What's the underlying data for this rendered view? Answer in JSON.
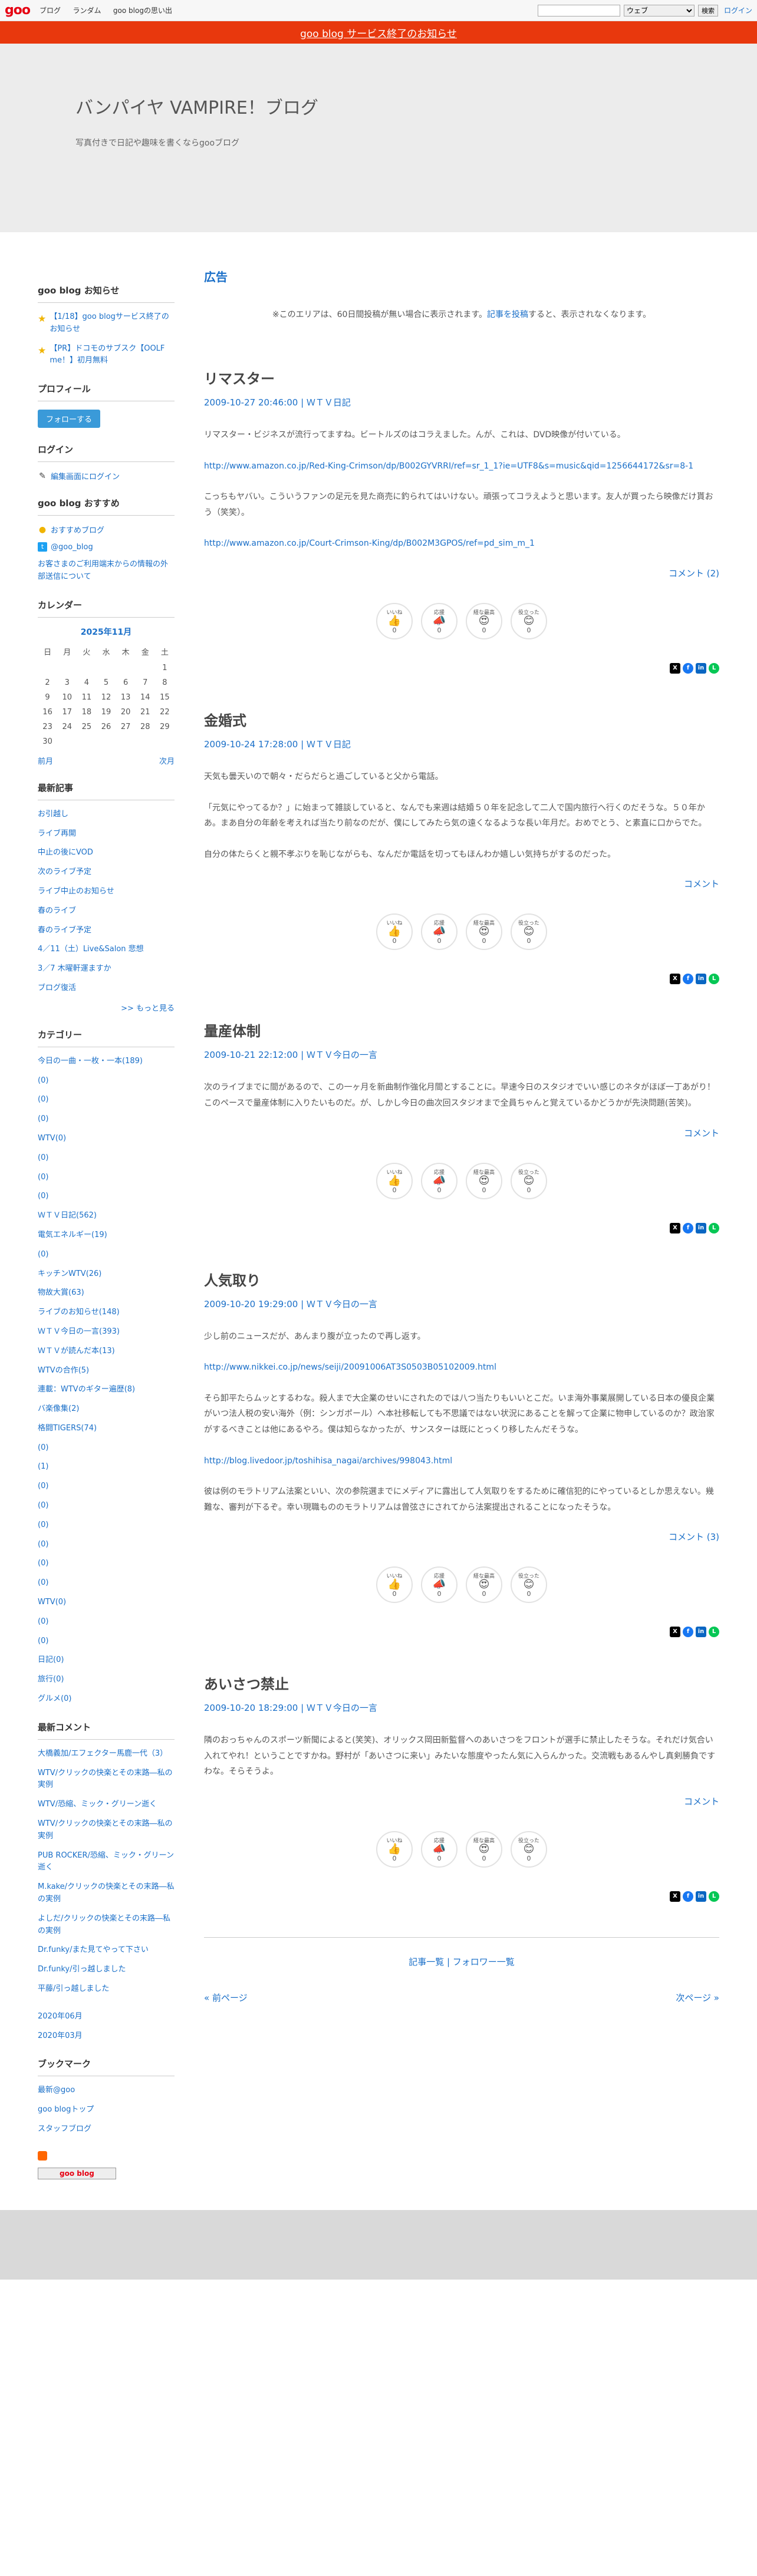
{
  "topbar": {
    "logo": "goo",
    "nav": [
      "ブログ",
      "ランダム",
      "goo blogの思い出"
    ],
    "search_scope": "ウェブ",
    "search_button": "検索",
    "login": "ログイン"
  },
  "notice_bar": "goo blog サービス終了のお知らせ",
  "header": {
    "title": "バンパイヤ VAMPIRE！ブログ",
    "description": "写真付きで日記や趣味を書くならgooブログ"
  },
  "sidebar": {
    "notice": {
      "title": "goo blog お知らせ",
      "items": [
        "【1/18】goo blogサービス終了のお知らせ",
        "【PR】ドコモのサブスク【OOLF me！】初月無料"
      ]
    },
    "profile": {
      "title": "プロフィール",
      "follow": "フォローする"
    },
    "login": {
      "title": "ログイン",
      "link": "編集画面にログイン"
    },
    "recommend": {
      "title": "goo blog おすすめ",
      "items": [
        "おすすめブログ",
        "@goo_blog",
        "お客さまのご利用端末からの情報の外部送信について"
      ]
    },
    "calendar": {
      "title": "カレンダー",
      "month": "2025年11月",
      "weekdays": [
        "日",
        "月",
        "火",
        "水",
        "木",
        "金",
        "土"
      ],
      "weeks": [
        [
          "",
          "",
          "",
          "",
          "",
          "",
          "1"
        ],
        [
          "2",
          "3",
          "4",
          "5",
          "6",
          "7",
          "8"
        ],
        [
          "9",
          "10",
          "11",
          "12",
          "13",
          "14",
          "15"
        ],
        [
          "16",
          "17",
          "18",
          "19",
          "20",
          "21",
          "22"
        ],
        [
          "23",
          "24",
          "25",
          "26",
          "27",
          "28",
          "29"
        ],
        [
          "30",
          "",
          "",
          "",
          "",
          "",
          ""
        ]
      ],
      "prev": "前月",
      "next": "次月"
    },
    "recent": {
      "title": "最新記事",
      "items": [
        "お引越し",
        "ライブ再開",
        "中止の後にVOD",
        "次のライブ予定",
        "ライブ中止のお知らせ",
        "春のライブ",
        "春のライブ予定",
        "4／11（土）Live&Salon 悲想",
        "3／7 木曜軒運ますか",
        "ブログ復活"
      ],
      "more": ">> もっと見る"
    },
    "categories": {
      "title": "カテゴリー",
      "items": [
        "今日の一曲・一枚・一本(189)",
        "(0)",
        "(0)",
        "(0)",
        "WTV(0)",
        "(0)",
        "(0)",
        "(0)",
        "ＷＴＶ日記(562)",
        "電気エネルギー(19)",
        "(0)",
        "キッチンWTV(26)",
        "物故大賞(63)",
        "ライブのお知らせ(148)",
        "ＷＴＶ今日の一言(393)",
        "ＷＴＶが読んだ本(13)",
        "WTVの合作(5)",
        "連載：WTVのギター遍歴(8)",
        "バ楽像集(2)",
        "格闘TIGERS(74)",
        "(0)",
        "(1)",
        "(0)",
        "(0)",
        "(0)",
        "(0)",
        "(0)",
        "(0)",
        "WTV(0)",
        "(0)",
        "(0)",
        "日記(0)",
        "旅行(0)",
        "グルメ(0)"
      ]
    },
    "comments": {
      "title": "最新コメント",
      "items": [
        "大橋義加/エフェクター馬鹿一代（3）",
        "WTV/クリックの快楽とその末路―私の実例",
        "WTV/恐縮、ミック・グリーン逝く",
        "WTV/クリックの快楽とその末路―私の実例",
        "PUB ROCKER/恐縮、ミック・グリーン逝く",
        "M.kake/クリックの快楽とその末路―私の実例",
        "よしだ/クリックの快楽とその末路―私の実例",
        "Dr.funky/また見てやって下さい",
        "Dr.funky/引っ越しました",
        "平藤/引っ越しました"
      ]
    },
    "archive": {
      "items": [
        "2020年06月",
        "2020年03月"
      ]
    },
    "bookmark": {
      "title": "ブックマーク",
      "items": [
        "最新@goo",
        "goo blogトップ",
        "スタッフブログ"
      ]
    },
    "footer_badge": "goo blog"
  },
  "main": {
    "ad_title": "広告",
    "ad_note_pre": "※このエリアは、60日間投稿が無い場合に表示されます。",
    "ad_note_link": "記事を投稿",
    "ad_note_post": "すると、表示されなくなります。",
    "reaction_labels": [
      "いいね",
      "応援",
      "経な最高",
      "役立った"
    ],
    "reaction_counts": [
      "0",
      "0",
      "0",
      "0"
    ],
    "entries": [
      {
        "title": "リマスター",
        "date": "2009-10-27 20:46:00",
        "category": "ＷＴＶ日記",
        "p1": "リマスター・ビジネスが流行ってますね。ビートルズのはコラえました。んが、これは、DVD映像が付いている。",
        "link1": "http://www.amazon.co.jp/Red-King-Crimson/dp/B002GYVRRI/ref=sr_1_1?ie=UTF8&s=music&qid=1256644172&sr=8-1",
        "p2": "こっちもヤバい。こういうファンの足元を見た商売に釣られてはいけない。頑張ってコラえようと思います。友人が買ったら映像だけ貰おう（笑笑）。",
        "link2": "http://www.amazon.co.jp/Court-Crimson-King/dp/B002M3GPOS/ref=pd_sim_m_1",
        "comment": "コメント (2)"
      },
      {
        "title": "金婚式",
        "date": "2009-10-24 17:28:00",
        "category": "ＷＴＶ日記",
        "p1": "天気も曇天いので朝々・だらだらと過ごしていると父から電話。",
        "p2": "「元気にやってるか？」に始まって雑談していると、なんでも来週は結婚５０年を記念して二人で国内旅行へ行くのだそうな。５０年かあ。まあ自分の年齢を考えれば当たり前なのだが、僕にしてみたら気の遠くなるような長い年月だ。おめでとう、と素直に口からでた。",
        "p3": "自分の体たらくと親不孝ぶりを恥じながらも、なんだか電話を切ってもほんわか嬉しい気持ちがするのだった。",
        "comment": "コメント"
      },
      {
        "title": "量産体制",
        "date": "2009-10-21 22:12:00",
        "category": "ＷＴＶ今日の一言",
        "p1": "次のライブまでに間があるので、この一ヶ月を新曲制作強化月間とすることに。早速今日のスタジオでいい感じのネタがほぼ一丁あがり！このペースで量産体制に入りたいものだ。が、しかし今日の曲次回スタジオまで全員ちゃんと覚えているかどうかが先決問題(苦笑)。",
        "comment": "コメント"
      },
      {
        "title": "人気取り",
        "date": "2009-10-20 19:29:00",
        "category": "ＷＴＶ今日の一言",
        "p1": "少し前のニュースだが、あんまり腹が立ったので再し返す。",
        "link1": "http://www.nikkei.co.jp/news/seiji/20091006AT3S0503B05102009.html",
        "p2": "そら卸平たらムッとするわな。殺人まで大企業のせいにされたのでは八つ当たりもいいとこだ。いま海外事業展開している日本の優良企業がいつ法人税の安い海外（例：シンガポール）へ本社移転しても不思議ではない状況にあることを解って企業に物申しているのか？政治家がするべきことは他にあるやろ。僕は知らなかったが、サンスターは既にとっくり移したんだそうな。",
        "link2": "http://blog.livedoor.jp/toshihisa_nagai/archives/998043.html",
        "p3": "彼は例のモラトリアム法案といい、次の参院選までにメディアに露出して人気取りをするために確信犯的にやっているとしか思えない。幾難な、審判が下るぞ。幸い現職もののモラトリアムは曾弦さにされてから法案提出されることになったそうな。",
        "comment": "コメント (3)"
      },
      {
        "title": "あいさつ禁止",
        "date": "2009-10-20 18:29:00",
        "category": "ＷＴＶ今日の一言",
        "p1": "隣のおっちゃんのスポーツ新聞によると(笑笑)、オリックス岡田新監督へのあいさつをフロントが選手に禁止したそうな。それだけ気合い入れてやれ！ということですかね。野村が「あいさつに来い」みたいな態度やったん気に入らんかった。交流戦もあるんやし真剣勝負ですわな。そらそうよ。",
        "comment": "コメント"
      }
    ],
    "bottom_links": "記事一覧 | フォロワー一覧",
    "prev_page": "« 前ページ",
    "next_page": "次ページ »"
  }
}
